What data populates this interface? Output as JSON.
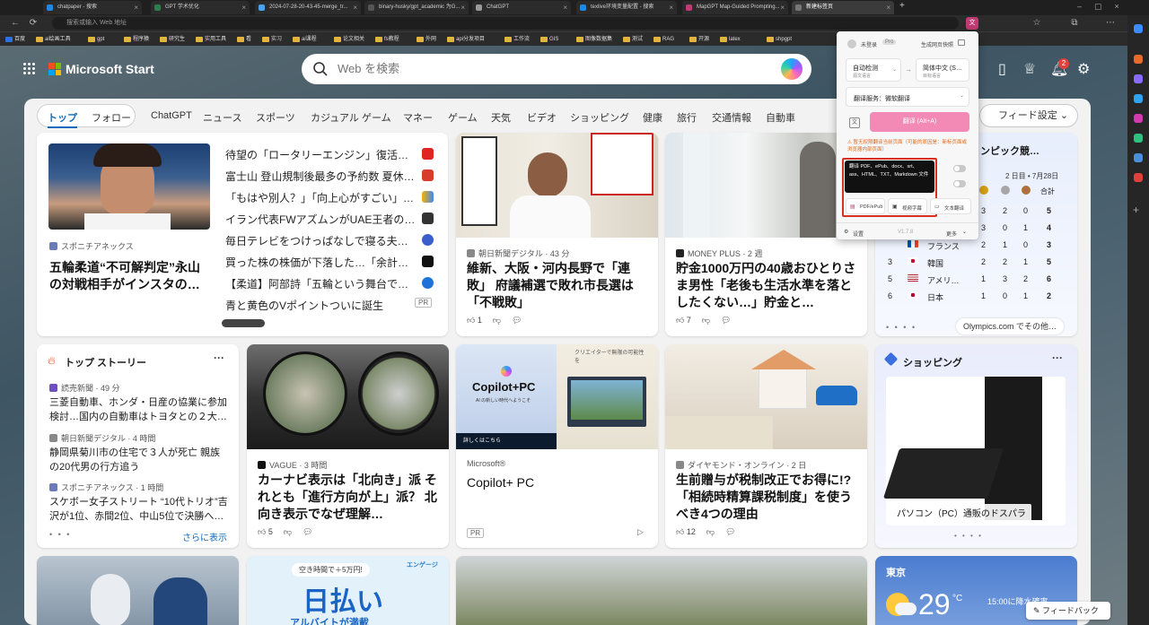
{
  "tabs": [
    {
      "label": "chatpaper - 搜索",
      "color": "#1e88e5"
    },
    {
      "label": "GPT 学术优化",
      "color": "#2f7d4f"
    },
    {
      "label": "2024-07-28-20-43-45-merge_tr...",
      "color": "#4aa3f0"
    },
    {
      "label": "binary-husky/gpt_academic 为G...",
      "color": "#555"
    },
    {
      "label": "ChatGPT",
      "color": "#999"
    },
    {
      "label": "texlive环境变量配置 - 搜索",
      "color": "#1e88e5"
    },
    {
      "label": "MapGPT Map-Guided Prompting...",
      "color": "#c23a73"
    },
    {
      "label": "新建标签页",
      "color": "#777"
    }
  ],
  "address": {
    "placeholder": "搜索或输入 Web 地址"
  },
  "bookmarks": [
    "百度",
    "ai绘画工具",
    "gpt",
    "程序猿",
    "研究生",
    "实用工具",
    "看",
    "实习",
    "ai课程",
    "论文相关",
    "fs教程",
    "外网",
    "api分发项目",
    "工作流",
    "GIS",
    "图像数据集",
    "测试",
    "RAG",
    "开源",
    "latex",
    "shpgpt"
  ],
  "header": {
    "brand": "Microsoft Start",
    "search_placeholder": "Web を検索",
    "notif_count": "2"
  },
  "nav": {
    "pill": [
      "トップ",
      "フォロー"
    ],
    "items": [
      "ChatGPT",
      "ニュース",
      "スポーツ",
      "カジュアル ゲーム",
      "マネー",
      "ゲーム",
      "天気",
      "ビデオ",
      "ショッピング",
      "健康",
      "旅行",
      "交通情報",
      "自動車"
    ],
    "feed_settings": "フィード設定"
  },
  "hero": {
    "source": "スポニチアネックス",
    "headline": "五輪柔道“不可解判定”永山の対戦相手がインスタの…",
    "list": [
      "待望の「ロータリーエンジン」復活…",
      "富士山 登山規制後最多の予約数 夏休…",
      "「もはや別人？」「向上心がすごい」…",
      "イラン代表FWアズムンがUAE王者の…",
      "毎日テレビをつけっぱなしで寝る夫…",
      "買った株の株価が下落した…「余計…",
      "【柔道】阿部詩「五輪という舞台で…",
      "青と黄色のVポイントついに誕生"
    ],
    "pr": "PR"
  },
  "card_asahi": {
    "source": "朝日新聞デジタル · 43 分",
    "headline": "維新、大阪・河内長野で「連敗」 府議補選で敗れ市長選は「不戦敗」",
    "likes": "1"
  },
  "card_money": {
    "source": "MONEY PLUS · 2 週",
    "headline": "貯金1000万円の40歳おひとりさま男性「老後も生活水準を落としたくない…」貯金と…",
    "likes": "7"
  },
  "olympics": {
    "title": "ンピック競…",
    "date": "2 日目 • 7月28日",
    "total_label": "合計",
    "rows": [
      {
        "rank": "",
        "country": "",
        "g": "3",
        "s": "2",
        "b": "0",
        "t": "5"
      },
      {
        "rank": "",
        "country": "",
        "g": "3",
        "s": "0",
        "b": "1",
        "t": "4"
      },
      {
        "rank": "",
        "country": "",
        "g": "2",
        "s": "1",
        "b": "0",
        "t": "3"
      },
      {
        "rank": "",
        "country": "フランス",
        "g": "2",
        "s": "2",
        "b": "1",
        "t": "5"
      },
      {
        "rank": "3",
        "country": "韓国",
        "g": "2",
        "s": "2",
        "b": "1",
        "t": "5"
      },
      {
        "rank": "5",
        "country": "アメリ…",
        "g": "1",
        "s": "3",
        "b": "2",
        "t": "6"
      },
      {
        "rank": "6",
        "country": "日本",
        "g": "1",
        "s": "0",
        "b": "1",
        "t": "2"
      }
    ],
    "footer": "Olympics.com でその他…"
  },
  "top_stories": {
    "title": "トップ ストーリー",
    "items": [
      {
        "source": "読売新聞 · 49 分",
        "headline": "三菱自動車、ホンダ・日産の協業に参加検討…国内の自動車はトヨタとの２大…"
      },
      {
        "source": "朝日新聞デジタル · 4 時間",
        "headline": "静岡県菊川市の住宅で３人が死亡 親族の20代男の行方追う"
      },
      {
        "source": "スポニチアネックス · 1 時間",
        "headline": "スケボー女子ストリート “10代トリオ”吉沢が1位、赤間2位、中山5位で決勝へ…"
      }
    ],
    "more": "さらに表示"
  },
  "card_vague": {
    "source": "VAGUE · 3 時間",
    "headline": "カーナビ表示は「北向き」派 それとも「進行方向が上」派？ 北向き表示でなぜ理解…",
    "likes": "5"
  },
  "card_copilot": {
    "img_title": "Copilot+PC",
    "img_sub": "AI の新しい時代へようこそ",
    "img_cta": "詳しくはこちら",
    "img_right": "クリエイターで無限の可能性を",
    "source": "Microsoft®",
    "headline": "Copilot+ PC",
    "pr": "PR"
  },
  "card_diamond": {
    "source": "ダイヤモンド・オンライン · 2 日",
    "headline": "生前贈与が税制改正でお得に!?「相続時精算課税制度」を使うべき4つの理由",
    "likes": "12"
  },
  "shopping": {
    "title": "ショッピング",
    "caption": "パソコン（PC）通販のドスパラ"
  },
  "bottom": {
    "ad_line": "空き時間で＋5万円!",
    "ad_brand": "エンゲージ",
    "ad_big": "日払い",
    "ad_sub": "アルバイトが満載"
  },
  "weather": {
    "city": "東京",
    "temp": "29",
    "unit": "°C",
    "note": "15:00に降水確率"
  },
  "feedback": "フィードバック",
  "ext": {
    "user": "未登录",
    "pro": "Pro",
    "snapshot": "生成网页快照",
    "src_lang": "自动检测",
    "src_sub": "源文语言",
    "tgt_lang": "简体中文 (S…",
    "tgt_sub": "目标语言",
    "service": "翻译服务：微软翻译",
    "translate": "翻译 (Alt+A)",
    "warning": "暂无权限翻译当前页面（可能的原因是：新标页面或浏览器内部页面）",
    "tooltip": "翻译 PDF、ePub、docx、srt、ass、HTML、TXT、Markdown 文件",
    "btn_pdf": "PDF/ePub",
    "btn_video": "视频字幕",
    "btn_text": "文本翻译",
    "settings": "设置",
    "version": "V1.7.8",
    "more": "更多"
  },
  "colors": {
    "accent": "#0f6cbd",
    "translate_btn": "#f28ab5",
    "red_box": "#d93025"
  }
}
